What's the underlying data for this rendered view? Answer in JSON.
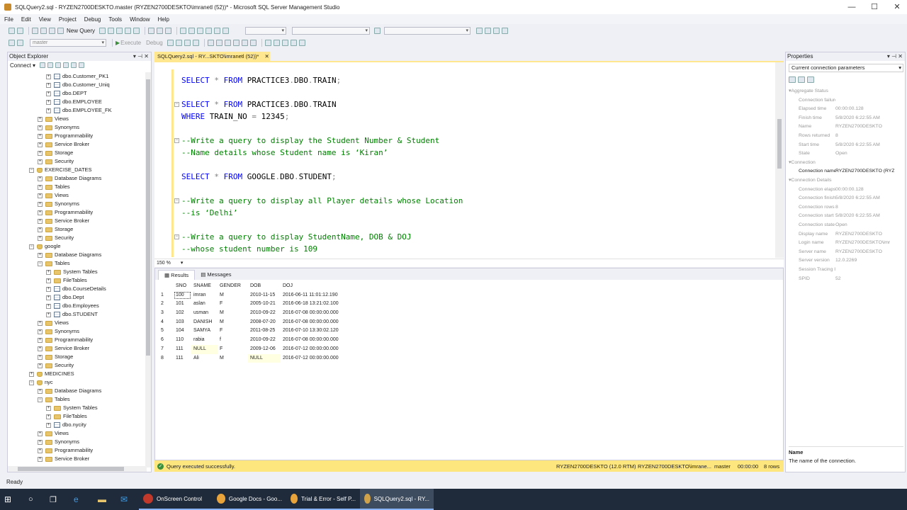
{
  "window": {
    "title": "SQLQuery2.sql - RYZEN2700DESKTO.master (RYZEN2700DESKTO\\imranetl (52))* - Microsoft SQL Server Management Studio",
    "minimize": "—",
    "maximize": "☐",
    "close": "✕"
  },
  "menu": [
    "File",
    "Edit",
    "View",
    "Project",
    "Debug",
    "Tools",
    "Window",
    "Help"
  ],
  "toolbar": {
    "new_query": "New Query",
    "execute": "Execute",
    "debug": "Debug",
    "database": "master"
  },
  "object_explorer": {
    "title": "Object Explorer",
    "connect": "Connect ▾",
    "tree": [
      {
        "label": "dbo.Customer_PK1",
        "level": 5,
        "icon": "table"
      },
      {
        "label": "dbo.Customer_Uniq",
        "level": 5,
        "icon": "table"
      },
      {
        "label": "dbo.DEPT",
        "level": 5,
        "icon": "table"
      },
      {
        "label": "dbo.EMPLOYEE",
        "level": 5,
        "icon": "table"
      },
      {
        "label": "dbo.EMPLOYEE_FK",
        "level": 5,
        "icon": "table"
      },
      {
        "label": "Views",
        "level": 4,
        "icon": "folder"
      },
      {
        "label": "Synonyms",
        "level": 4,
        "icon": "folder"
      },
      {
        "label": "Programmability",
        "level": 4,
        "icon": "folder"
      },
      {
        "label": "Service Broker",
        "level": 4,
        "icon": "folder"
      },
      {
        "label": "Storage",
        "level": 4,
        "icon": "folder"
      },
      {
        "label": "Security",
        "level": 4,
        "icon": "folder"
      },
      {
        "label": "EXERCISE_DATES",
        "level": 3,
        "icon": "db",
        "open": true
      },
      {
        "label": "Database Diagrams",
        "level": 4,
        "icon": "folder"
      },
      {
        "label": "Tables",
        "level": 4,
        "icon": "folder"
      },
      {
        "label": "Views",
        "level": 4,
        "icon": "folder"
      },
      {
        "label": "Synonyms",
        "level": 4,
        "icon": "folder"
      },
      {
        "label": "Programmability",
        "level": 4,
        "icon": "folder"
      },
      {
        "label": "Service Broker",
        "level": 4,
        "icon": "folder"
      },
      {
        "label": "Storage",
        "level": 4,
        "icon": "folder"
      },
      {
        "label": "Security",
        "level": 4,
        "icon": "folder"
      },
      {
        "label": "google",
        "level": 3,
        "icon": "db",
        "open": true
      },
      {
        "label": "Database Diagrams",
        "level": 4,
        "icon": "folder"
      },
      {
        "label": "Tables",
        "level": 4,
        "icon": "folder",
        "open": true
      },
      {
        "label": "System Tables",
        "level": 5,
        "icon": "folder"
      },
      {
        "label": "FileTables",
        "level": 5,
        "icon": "folder"
      },
      {
        "label": "dbo.CourseDetails",
        "level": 5,
        "icon": "table"
      },
      {
        "label": "dbo.Dept",
        "level": 5,
        "icon": "table"
      },
      {
        "label": "dbo.Employees",
        "level": 5,
        "icon": "table"
      },
      {
        "label": "dbo.STUDENT",
        "level": 5,
        "icon": "table"
      },
      {
        "label": "Views",
        "level": 4,
        "icon": "folder"
      },
      {
        "label": "Synonyms",
        "level": 4,
        "icon": "folder"
      },
      {
        "label": "Programmability",
        "level": 4,
        "icon": "folder"
      },
      {
        "label": "Service Broker",
        "level": 4,
        "icon": "folder"
      },
      {
        "label": "Storage",
        "level": 4,
        "icon": "folder"
      },
      {
        "label": "Security",
        "level": 4,
        "icon": "folder"
      },
      {
        "label": "MEDICINES",
        "level": 3,
        "icon": "db"
      },
      {
        "label": "nyc",
        "level": 3,
        "icon": "db",
        "open": true
      },
      {
        "label": "Database Diagrams",
        "level": 4,
        "icon": "folder"
      },
      {
        "label": "Tables",
        "level": 4,
        "icon": "folder",
        "open": true
      },
      {
        "label": "System Tables",
        "level": 5,
        "icon": "folder"
      },
      {
        "label": "FileTables",
        "level": 5,
        "icon": "folder"
      },
      {
        "label": "dbo.nycity",
        "level": 5,
        "icon": "table"
      },
      {
        "label": "Views",
        "level": 4,
        "icon": "folder"
      },
      {
        "label": "Synonyms",
        "level": 4,
        "icon": "folder"
      },
      {
        "label": "Programmability",
        "level": 4,
        "icon": "folder"
      },
      {
        "label": "Service Broker",
        "level": 4,
        "icon": "folder"
      }
    ]
  },
  "editor": {
    "tab_label": "SQLQuery2.sql - RY...SKTO\\imranetl (52))*",
    "tab_close": "✕",
    "zoom": "150 %",
    "lines": [
      {
        "row": 1,
        "parts": [
          [
            "kw",
            "SELECT "
          ],
          [
            "gr",
            "* "
          ],
          [
            "kw",
            "FROM "
          ],
          [
            "bl",
            "PRACTICE3"
          ],
          [
            "gr",
            "."
          ],
          [
            "bl",
            "DBO"
          ],
          [
            "gr",
            "."
          ],
          [
            "bl",
            "TRAIN"
          ],
          [
            "gr",
            ";"
          ]
        ]
      },
      {
        "row": 3,
        "fold": true,
        "parts": [
          [
            "kw",
            "SELECT "
          ],
          [
            "gr",
            "* "
          ],
          [
            "kw",
            "FROM "
          ],
          [
            "bl",
            "PRACTICE3"
          ],
          [
            "gr",
            "."
          ],
          [
            "bl",
            "DBO"
          ],
          [
            "gr",
            "."
          ],
          [
            "bl",
            "TRAIN"
          ]
        ]
      },
      {
        "row": 4,
        "parts": [
          [
            "kw",
            "WHERE "
          ],
          [
            "bl",
            "TRAIN_NO "
          ],
          [
            "gr",
            "= "
          ],
          [
            "bl",
            "12345"
          ],
          [
            "gr",
            ";"
          ]
        ]
      },
      {
        "row": 6,
        "fold": true,
        "parts": [
          [
            "cm",
            "--Write a query to display the Student Number & Student"
          ]
        ]
      },
      {
        "row": 7,
        "parts": [
          [
            "cm",
            "--Name details whose Student name is ‘Kiran’"
          ]
        ]
      },
      {
        "row": 9,
        "parts": [
          [
            "kw",
            "SELECT "
          ],
          [
            "gr",
            "* "
          ],
          [
            "kw",
            "FROM "
          ],
          [
            "bl",
            "GOOGLE"
          ],
          [
            "gr",
            "."
          ],
          [
            "bl",
            "DBO"
          ],
          [
            "gr",
            "."
          ],
          [
            "bl",
            "STUDENT"
          ],
          [
            "gr",
            ";"
          ]
        ]
      },
      {
        "row": 11,
        "fold": true,
        "parts": [
          [
            "cm",
            "--Write a query to display all Player details whose Location"
          ]
        ]
      },
      {
        "row": 12,
        "parts": [
          [
            "cm",
            "--is ‘Delhi’"
          ]
        ]
      },
      {
        "row": 14,
        "fold": true,
        "parts": [
          [
            "cm",
            "--Write a query to display StudentName, DOB & DOJ"
          ]
        ]
      },
      {
        "row": 15,
        "parts": [
          [
            "cm",
            "--whose student number is 109"
          ]
        ]
      }
    ]
  },
  "results": {
    "tabs": [
      "Results",
      "Messages"
    ],
    "columns": [
      "",
      "SNO",
      "SNAME",
      "GENDER",
      "DOB",
      "DOJ"
    ],
    "rows": [
      [
        "1",
        "100",
        "imran",
        "M",
        "2010-11-15",
        "2016-06-11 11:01:12.190"
      ],
      [
        "2",
        "101",
        "aslan",
        "F",
        "2005-10-21",
        "2016-06-18 13:21:02.100"
      ],
      [
        "3",
        "102",
        "usman",
        "M",
        "2010-09-22",
        "2016-07-08 00:00:00.000"
      ],
      [
        "4",
        "103",
        "DANISH",
        "M",
        "2008-07-20",
        "2016-07-08 00:00:00.000"
      ],
      [
        "5",
        "104",
        "SAMYA",
        "F",
        "2011-08-25",
        "2016-07-10 13:30:02.120"
      ],
      [
        "6",
        "110",
        "rabia",
        "f",
        "2010-09-22",
        "2016-07-08 00:00:00.000"
      ],
      [
        "7",
        "111",
        "NULL",
        "F",
        "2009-12-06",
        "2016-07-12 00:00:00.000"
      ],
      [
        "8",
        "111",
        "Ali",
        "M",
        "NULL",
        "2016-07-12 00:00:00.000"
      ]
    ]
  },
  "query_status": {
    "message": "Query executed successfully.",
    "server": "RYZEN2700DESKTO (12.0 RTM)",
    "login": "RYZEN2700DESKTO\\imrane...",
    "database": "master",
    "time": "00:00:00",
    "rows": "8 rows"
  },
  "properties": {
    "title": "Properties",
    "object": "Current connection parameters",
    "rows": [
      {
        "type": "cat",
        "label": "Aggregate Status",
        "dark": false
      },
      {
        "type": "prop",
        "name": "Connection failure",
        "value": "",
        "dark": false
      },
      {
        "type": "prop",
        "name": "Elapsed time",
        "value": "00:00:00.128",
        "dark": false
      },
      {
        "type": "prop",
        "name": "Finish time",
        "value": "5/8/2020 6:22:55 AM",
        "dark": false
      },
      {
        "type": "prop",
        "name": "Name",
        "value": "RYZEN2700DESKTO",
        "dark": false
      },
      {
        "type": "prop",
        "name": "Rows returned",
        "value": "8",
        "dark": false
      },
      {
        "type": "prop",
        "name": "Start time",
        "value": "5/8/2020 6:22:55 AM",
        "dark": false
      },
      {
        "type": "prop",
        "name": "State",
        "value": "Open",
        "dark": false
      },
      {
        "type": "cat",
        "label": "Connection",
        "dark": false
      },
      {
        "type": "prop",
        "name": "Connection name",
        "value": "RYZEN2700DESKTO (RYZ",
        "dark": true
      },
      {
        "type": "cat",
        "label": "Connection Details",
        "dark": false
      },
      {
        "type": "prop",
        "name": "Connection elapsed",
        "value": "00:00:00.128",
        "dark": false
      },
      {
        "type": "prop",
        "name": "Connection finish",
        "value": "5/8/2020 6:22:55 AM",
        "dark": false
      },
      {
        "type": "prop",
        "name": "Connection rows",
        "value": "8",
        "dark": false
      },
      {
        "type": "prop",
        "name": "Connection start",
        "value": "5/8/2020 6:22:55 AM",
        "dark": false
      },
      {
        "type": "prop",
        "name": "Connection state",
        "value": "Open",
        "dark": false
      },
      {
        "type": "prop",
        "name": "Display name",
        "value": "RYZEN2700DESKTO",
        "dark": false
      },
      {
        "type": "prop",
        "name": "Login name",
        "value": "RYZEN2700DESKTO\\imr",
        "dark": false
      },
      {
        "type": "prop",
        "name": "Server name",
        "value": "RYZEN2700DESKTO",
        "dark": false
      },
      {
        "type": "prop",
        "name": "Server version",
        "value": "12.0.2269",
        "dark": false
      },
      {
        "type": "prop",
        "name": "Session Tracing ID",
        "value": "",
        "dark": false
      },
      {
        "type": "prop",
        "name": "SPID",
        "value": "52",
        "dark": false
      }
    ],
    "desc_title": "Name",
    "desc_text": "The name of the connection."
  },
  "status_bar": {
    "text": "Ready"
  },
  "taskbar": {
    "items": [
      {
        "label": "OnScreen Control",
        "color": "#c0392b"
      },
      {
        "label": "Google Docs - Goo...",
        "color": "#e8a33b"
      },
      {
        "label": "Trial & Error - Self P...",
        "color": "#e8a33b"
      },
      {
        "label": "SQLQuery2.sql - RY...",
        "color": "#d0a24a"
      }
    ]
  }
}
